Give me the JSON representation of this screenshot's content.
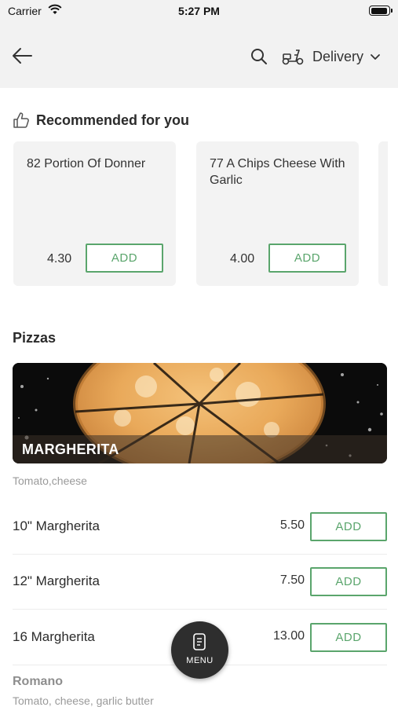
{
  "status_bar": {
    "carrier": "Carrier",
    "time": "5:27 PM",
    "icons": [
      "wifi-icon",
      "battery-icon"
    ]
  },
  "header": {
    "back_icon": "arrow-left-icon",
    "search_icon": "search-icon",
    "delivery_icon": "scooter-icon",
    "delivery_label": "Delivery",
    "dropdown_icon": "chevron-down-icon"
  },
  "recommended": {
    "icon": "thumbs-up-icon",
    "title": "Recommended for you",
    "items": [
      {
        "name": "82 Portion Of Donner",
        "price": "4.30",
        "add_label": "ADD"
      },
      {
        "name": "77 A Chips Cheese With Garlic",
        "price": "4.00",
        "add_label": "ADD"
      }
    ]
  },
  "pizzas": {
    "title": "Pizzas",
    "banner": {
      "title": "MARGHERITA",
      "description": "Tomato,cheese"
    },
    "items": [
      {
        "name": "10\" Margherita",
        "price": "5.50",
        "add_label": "ADD"
      },
      {
        "name": "12\" Margherita",
        "price": "7.50",
        "add_label": "ADD"
      },
      {
        "name": "16 Margherita",
        "price": "13.00",
        "add_label": "ADD"
      }
    ],
    "next": {
      "title": "Romano",
      "description": "Tomato, cheese, garlic butter"
    }
  },
  "menu_button": {
    "label": "MENU",
    "icon": "menu-card-icon"
  },
  "colors": {
    "accent": "#5aa56c",
    "header_bg": "#f2f2f2",
    "card_bg": "#f3f3f3",
    "fab_bg": "#2e2e2e"
  }
}
